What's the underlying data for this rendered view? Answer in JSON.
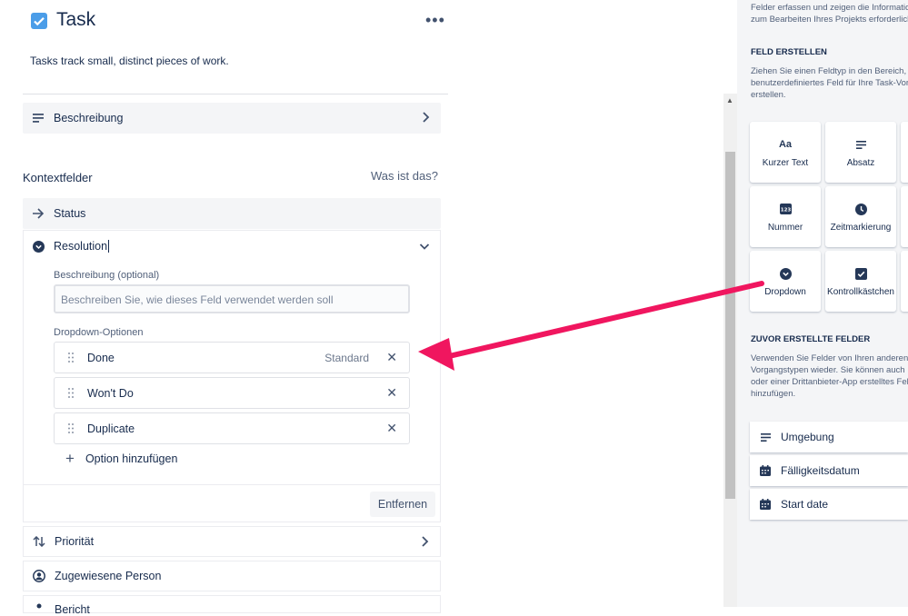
{
  "header": {
    "title": "Task",
    "more": "•••",
    "description": "Tasks track small, distinct pieces of work."
  },
  "rows": {
    "beschreibung": "Beschreibung"
  },
  "context": {
    "title": "Kontextfelder",
    "what_is_this": "Was ist das?"
  },
  "status": {
    "label": "Status"
  },
  "resolution": {
    "label": "Resolution",
    "desc_label": "Beschreibung (optional)",
    "desc_placeholder": "Beschreiben Sie, wie dieses Feld verwendet werden soll",
    "options_label": "Dropdown-Optionen",
    "options": [
      {
        "label": "Done",
        "badge": "Standard"
      },
      {
        "label": "Won't Do",
        "badge": ""
      },
      {
        "label": "Duplicate",
        "badge": ""
      }
    ],
    "add_option": "Option hinzufügen",
    "remove": "Entfernen"
  },
  "lower_rows": {
    "priority": "Priorität",
    "assignee": "Zugewiesene Person",
    "partial": "Bericht"
  },
  "right": {
    "intro_lines": [
      "Felder erfassen und zeigen die Informationen an, die",
      "zum Bearbeiten Ihres Projekts erforderlich sind."
    ],
    "create_title": "FELD ERSTELLEN",
    "create_lines": [
      "Ziehen Sie einen Feldtyp in den Bereich, um ein",
      "benutzerdefiniertes Feld für Ihre Task-Vorgänge zu",
      "erstellen."
    ],
    "field_types": [
      {
        "label": "Kurzer Text",
        "icon": "Aa"
      },
      {
        "label": "Absatz",
        "icon": "paragraph"
      },
      {
        "label": "Nummer",
        "icon": "123"
      },
      {
        "label": "Zeitmarkierung",
        "icon": "clock"
      },
      {
        "label": "Dropdown",
        "icon": "dropdown"
      },
      {
        "label": "Kontrollkästchen",
        "icon": "checkbox"
      }
    ],
    "prev_title": "ZUVOR ERSTELLTE FELDER",
    "prev_lines": [
      "Verwenden Sie Felder von Ihren anderen",
      "Vorgangstypen wieder. Sie können auch",
      "oder einer Drittanbieter-App erstelltes Feld",
      "hinzufügen."
    ],
    "prev_fields": [
      "Umgebung",
      "Fälligkeitsdatum",
      "Start date"
    ]
  },
  "colors": {
    "accent": "#4b9de8",
    "arrow": "#f0165f"
  }
}
